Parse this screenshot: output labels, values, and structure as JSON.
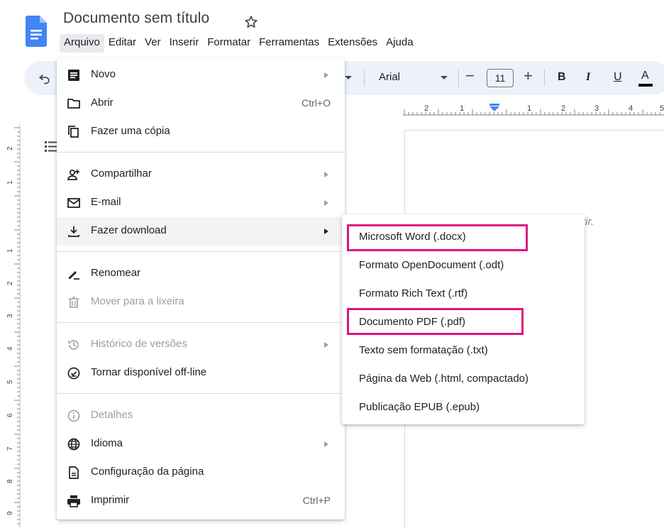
{
  "header": {
    "title": "Documento sem título",
    "menubar": [
      "Arquivo",
      "Editar",
      "Ver",
      "Inserir",
      "Formatar",
      "Ferramentas",
      "Extensões",
      "Ajuda"
    ]
  },
  "toolbar": {
    "font": "Arial",
    "font_size": "11",
    "minus": "−",
    "plus": "+",
    "bold": "B",
    "italic": "I",
    "underline": "U",
    "text_color": "A"
  },
  "ruler": {
    "horizontal_labels": [
      "2",
      "1",
      "1",
      "2",
      "3",
      "4",
      "5"
    ],
    "vertical_labels": [
      "2",
      "1",
      "1",
      "2",
      "3",
      "4",
      "5",
      "6",
      "7",
      "8",
      "9"
    ]
  },
  "page": {
    "hint_fragment": "nserir."
  },
  "file_menu": {
    "items": [
      {
        "label": "Novo",
        "shortcut": "",
        "icon": "new-doc-icon"
      },
      {
        "label": "Abrir",
        "shortcut": "Ctrl+O",
        "icon": "folder-icon"
      },
      {
        "label": "Fazer uma cópia",
        "shortcut": "",
        "icon": "copy-icon"
      },
      {
        "label": "Compartilhar",
        "shortcut": "",
        "icon": "share-person-icon"
      },
      {
        "label": "E-mail",
        "shortcut": "",
        "icon": "mail-icon"
      },
      {
        "label": "Fazer download",
        "shortcut": "",
        "icon": "download-icon"
      },
      {
        "label": "Renomear",
        "shortcut": "",
        "icon": "rename-icon"
      },
      {
        "label": "Mover para a lixeira",
        "shortcut": "",
        "icon": "trash-icon"
      },
      {
        "label": "Histórico de versões",
        "shortcut": "",
        "icon": "history-icon"
      },
      {
        "label": "Tornar disponível off-line",
        "shortcut": "",
        "icon": "offline-icon"
      },
      {
        "label": "Detalhes",
        "shortcut": "",
        "icon": "info-icon"
      },
      {
        "label": "Idioma",
        "shortcut": "",
        "icon": "globe-icon"
      },
      {
        "label": "Configuração da página",
        "shortcut": "",
        "icon": "page-setup-icon"
      },
      {
        "label": "Imprimir",
        "shortcut": "Ctrl+P",
        "icon": "print-icon"
      }
    ]
  },
  "download_submenu": {
    "items": [
      "Microsoft Word (.docx)",
      "Formato OpenDocument (.odt)",
      "Formato Rich Text (.rtf)",
      "Documento PDF (.pdf)",
      "Texto sem formatação (.txt)",
      "Página da Web (.html, compactado)",
      "Publicação EPUB (.epub)"
    ],
    "highlight_color": "#e0137f"
  },
  "colors": {
    "docs_blue": "#4285f4",
    "toolbar_bg": "#edf2fa",
    "menu_hover": "#f1f3f4",
    "disabled_text": "#9aa0a6"
  }
}
